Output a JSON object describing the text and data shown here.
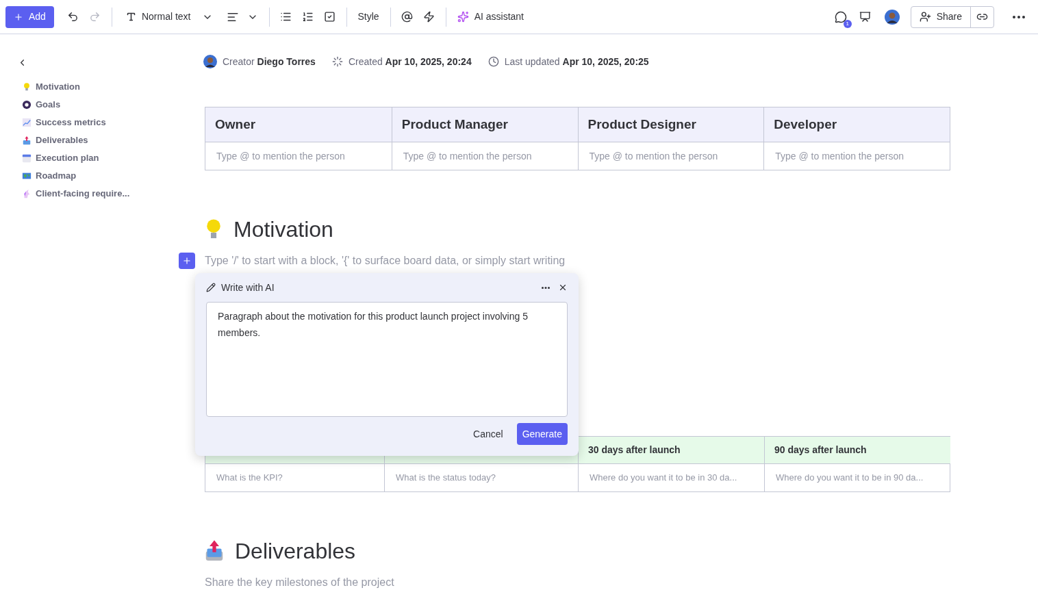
{
  "toolbar": {
    "add": "Add",
    "text_style": "Normal text",
    "style": "Style",
    "ai": "AI assistant",
    "notifications": "1",
    "share": "Share"
  },
  "sidebar": {
    "items": [
      {
        "label": "Motivation"
      },
      {
        "label": "Goals"
      },
      {
        "label": "Success metrics"
      },
      {
        "label": "Deliverables"
      },
      {
        "label": "Execution plan"
      },
      {
        "label": "Roadmap"
      },
      {
        "label": "Client-facing require..."
      }
    ]
  },
  "meta": {
    "creator_label": "Creator",
    "creator": "Diego Torres",
    "created_label": "Created",
    "created": "Apr 10, 2025, 20:24",
    "updated_label": "Last updated",
    "updated": "Apr 10, 2025, 20:25"
  },
  "team_table": {
    "columns": [
      "Owner",
      "Product Manager",
      "Product Designer",
      "Developer"
    ],
    "cells": [
      "Type @ to mention the person",
      "Type @ to mention the person",
      "Type @ to mention the person",
      "Type @ to mention the person"
    ]
  },
  "motivation": {
    "heading": "Motivation",
    "placeholder": "Type '/' to start with a block, '{' to surface board data, or simply start writing"
  },
  "ai_popup": {
    "title": "Write with AI",
    "value": "Paragraph about the motivation for this product launch project involving 5 members.",
    "cancel": "Cancel",
    "generate": "Generate"
  },
  "metrics_table": {
    "columns": [
      null,
      null,
      "30 days after launch",
      "90 days after launch"
    ],
    "cells": [
      "What is the KPI?",
      "What is the status today?",
      "Where do you want it to be in 30 da...",
      "Where do you want it to be in 90 da..."
    ]
  },
  "deliverables": {
    "heading": "Deliverables",
    "subtitle": "Share the key milestones of the project"
  }
}
